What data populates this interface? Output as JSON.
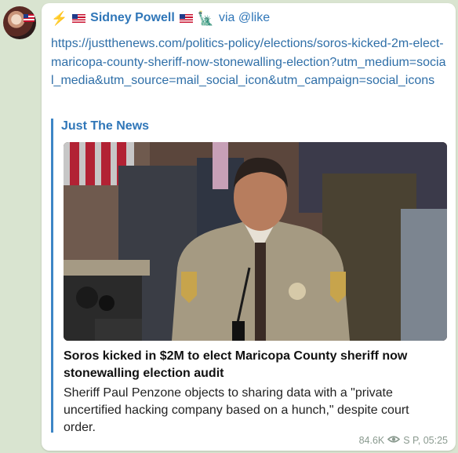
{
  "post": {
    "author": "Sidney Powell",
    "via": "via @like",
    "url": "https://justthenews.com/politics-policy/elections/soros-kicked-2m-elect-maricopa-county-sheriff-now-stonewalling-election?utm_medium=social_media&utm_source=mail_social_icon&utm_campaign=social_icons"
  },
  "preview": {
    "site": "Just The News",
    "title": "Soros kicked in $2M to elect Maricopa County sheriff now stonewalling election audit",
    "description": "Sheriff Paul Penzone objects to sharing data with a \"private uncertified hacking company based on a hunch,\" despite court order."
  },
  "meta": {
    "views": "84.6K",
    "signature": "S P, 05:25"
  },
  "icons": {
    "avatar": "avatar",
    "bolt": "lightning-icon",
    "flag": "us-flag-icon",
    "liberty": "statue-of-liberty-icon",
    "views": "eye-icon"
  },
  "colors": {
    "background": "#d9e4d0",
    "link": "#2f6fa8",
    "accent": "#2f76b8",
    "preview_bar": "#3d86c6"
  }
}
